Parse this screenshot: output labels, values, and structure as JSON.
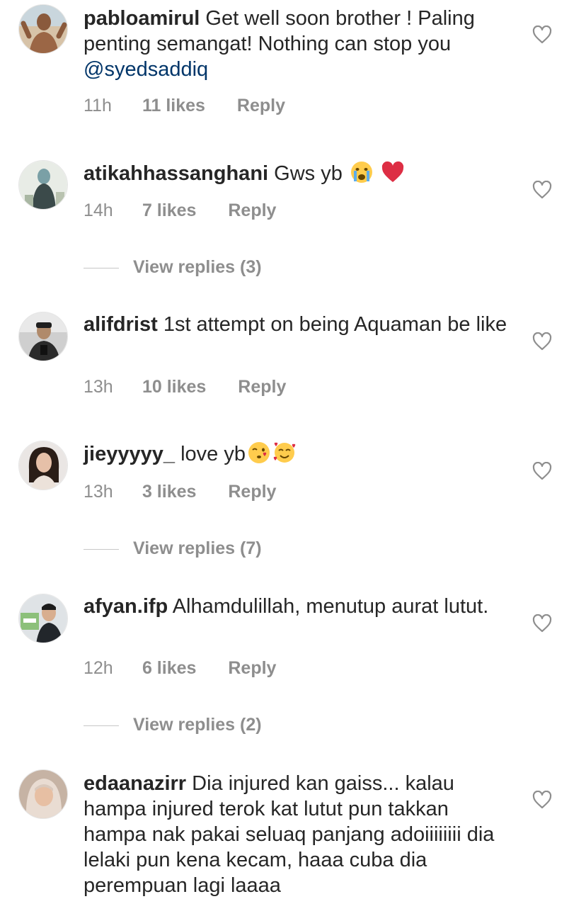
{
  "comments": [
    {
      "username": "pabloamirul",
      "text": "Get well soon brother ! Paling penting semangat! Nothing can stop you ",
      "mention": "@syedsaddiq",
      "time": "11h",
      "likes": "11 likes",
      "reply": "Reply",
      "avatar_icon": "user-photo"
    },
    {
      "username": "atikahhassanghani",
      "text": "Gws yb",
      "emojis": [
        "crying-face-emoji",
        "red-heart-emoji"
      ],
      "time": "14h",
      "likes": "7 likes",
      "reply": "Reply",
      "view_replies": "View replies (3)",
      "avatar_icon": "user-photo"
    },
    {
      "username": "alifdrist",
      "text": "1st attempt on being Aquaman be like",
      "time": "13h",
      "likes": "10 likes",
      "reply": "Reply",
      "avatar_icon": "user-photo"
    },
    {
      "username": "jieyyyyy_",
      "text": "love yb",
      "emojis": [
        "kissing-face-emoji",
        "smiling-face-with-hearts-emoji"
      ],
      "time": "13h",
      "likes": "3 likes",
      "reply": "Reply",
      "view_replies": "View replies (7)",
      "avatar_icon": "user-photo"
    },
    {
      "username": "afyan.ifp",
      "text": "Alhamdulillah, menutup aurat lutut.",
      "time": "12h",
      "likes": "6 likes",
      "reply": "Reply",
      "view_replies": "View replies (2)",
      "avatar_icon": "user-photo"
    },
    {
      "username": "edaanazirr",
      "text": "Dia injured kan gaiss... kalau hampa injured terok kat lutut  pun takkan hampa nak pakai seluaq panjang adoiiiiiiii dia lelaki pun kena kecam, haaa cuba dia perempuan lagi laaaa",
      "avatar_icon": "user-photo"
    }
  ],
  "colors": {
    "text": "#262626",
    "meta": "#8e8e8e",
    "mention": "#003569",
    "divider": "#c7c7c7",
    "heart_outline": "#8e8e8e"
  },
  "icons": {
    "like": "heart-outline-icon"
  }
}
